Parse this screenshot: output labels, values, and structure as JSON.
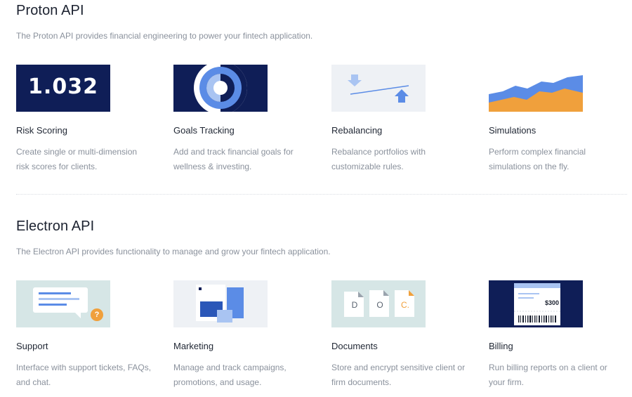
{
  "proton": {
    "title": "Proton API",
    "description": "The Proton API provides financial engineering to power your fintech application.",
    "cards": [
      {
        "title": "Risk Scoring",
        "desc_line1": "Create single or multi-dimension",
        "desc_line2": "risk scores for clients.",
        "thumb_value": "1.032"
      },
      {
        "title": "Goals Tracking",
        "desc_line1": "Add and track financial goals for",
        "desc_line2": "wellness & investing."
      },
      {
        "title": "Rebalancing",
        "desc_line1": "Rebalance portfolios with",
        "desc_line2": "customizable rules."
      },
      {
        "title": "Simulations",
        "desc_line1": "Perform complex financial",
        "desc_line2": "simulations on the fly."
      }
    ]
  },
  "electron": {
    "title": "Electron API",
    "description": "The Electron API provides functionality to manage and grow your fintech application.",
    "cards": [
      {
        "title": "Support",
        "desc_line1": "Interface with support tickets, FAQs,",
        "desc_line2": "and chat.",
        "thumb_badge": "?"
      },
      {
        "title": "Marketing",
        "desc_line1": "Manage and track campaigns,",
        "desc_line2": "promotions, and usage."
      },
      {
        "title": "Documents",
        "desc_line1": "Store and encrypt sensitive client or",
        "desc_line2": "firm documents.",
        "thumb_letters": [
          "D",
          "O",
          "C."
        ]
      },
      {
        "title": "Billing",
        "desc_line1": "Run billing reports on a client or",
        "desc_line2": "your firm.",
        "thumb_amount": "$300"
      }
    ]
  },
  "colors": {
    "navy": "#0f1e57",
    "blue": "#5b8ce6",
    "light_blue": "#a9c4f2",
    "orange": "#f0a03c",
    "mint": "#d6e6e6",
    "text_muted": "#8a919c"
  },
  "icons": {
    "risk_scoring": "number-tile-icon",
    "goals_tracking": "target-ring-icon",
    "rebalancing": "arrows-balance-icon",
    "simulations": "area-chart-icon",
    "support": "chat-bubble-icon",
    "marketing": "layout-panels-icon",
    "documents": "document-stack-icon",
    "billing": "invoice-barcode-icon"
  }
}
